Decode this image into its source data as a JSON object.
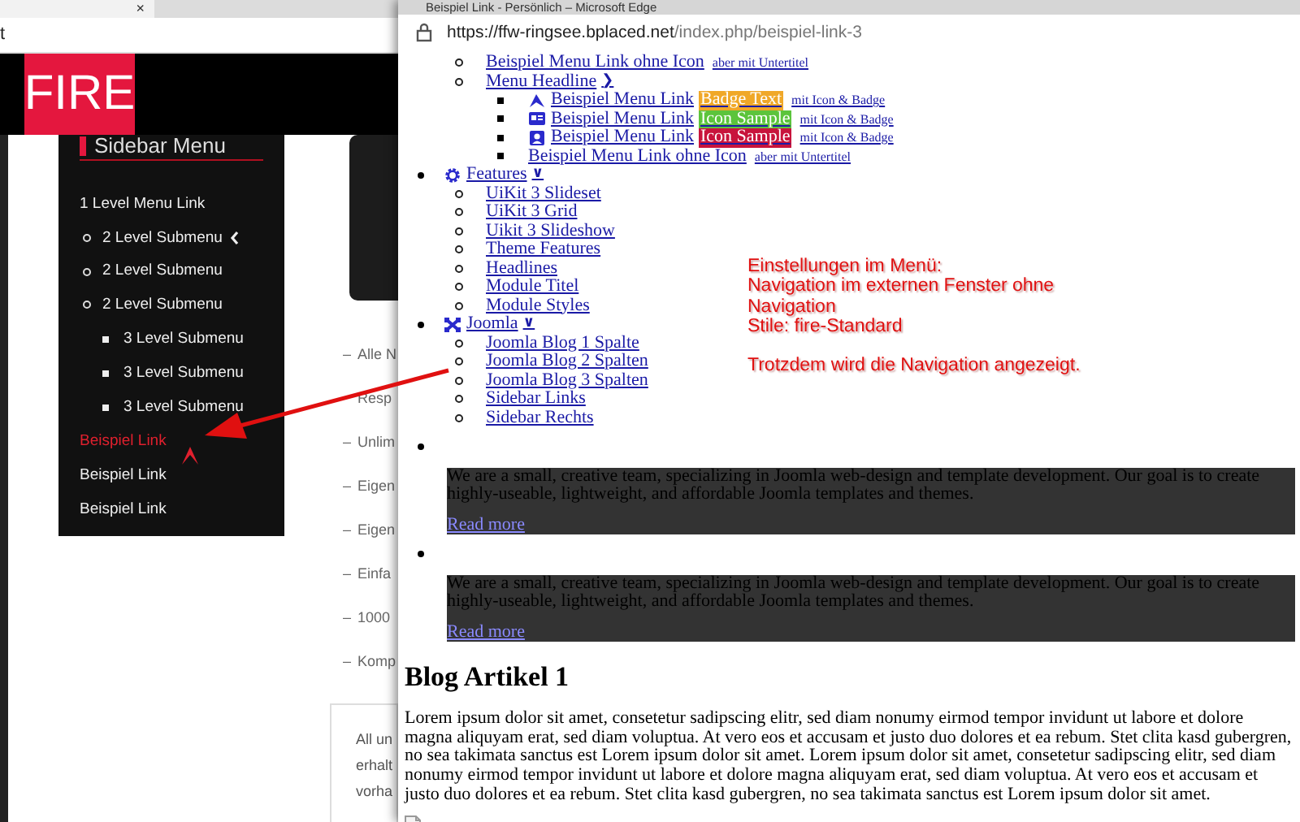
{
  "background_page": {
    "tab_close": "×",
    "address_fragment": "t",
    "logo": "FIRE",
    "sidebar": {
      "title": "Sidebar Menu",
      "items": [
        {
          "label": "1 Level Menu Link",
          "selected": false,
          "children": [
            {
              "label": "2 Level Submenu",
              "selected": false,
              "chevron": true
            },
            {
              "label": "2 Level Submenu",
              "selected": false,
              "chevron": false
            },
            {
              "label": "2 Level Submenu",
              "selected": false,
              "chevron": false,
              "children": [
                {
                  "label": "3 Level Submenu",
                  "selected": false
                },
                {
                  "label": "3 Level Submenu",
                  "selected": false
                },
                {
                  "label": "3 Level Submenu",
                  "selected": false
                }
              ]
            }
          ]
        },
        {
          "label": "Beispiel Link",
          "selected": true
        },
        {
          "label": "Beispiel Link",
          "selected": false
        },
        {
          "label": "Beispiel Link",
          "selected": false
        }
      ]
    },
    "feature_list": [
      {
        "marker": "–",
        "lines": [
          "Alle N",
          "Resp"
        ]
      },
      {
        "marker": "–",
        "lines": [
          "Unlim"
        ]
      },
      {
        "marker": "–",
        "lines": [
          "Eigen"
        ]
      },
      {
        "marker": "–",
        "lines": [
          "Eigen"
        ]
      },
      {
        "marker": "–",
        "lines": [
          "Einfa"
        ]
      },
      {
        "marker": "–",
        "lines": [
          "1000"
        ]
      },
      {
        "marker": "–",
        "lines": [
          "Komp"
        ]
      }
    ],
    "info_box": {
      "lines": [
        "All un",
        "erhalt",
        "vorha"
      ]
    }
  },
  "popup": {
    "title": "Beispiel Link - Persönlich – Microsoft Edge",
    "url_host": "https://ffw-ringsee.bplaced.net",
    "url_path": "/index.php/beispiel-link-3",
    "menu_continued": [
      {
        "label": "Beispiel Menu Link ohne Icon",
        "subtitle": "aber mit Untertitel"
      },
      {
        "label": "Menu Headline",
        "chevron": "❯",
        "children": [
          {
            "kind": "icon",
            "label": "Beispiel Menu Link",
            "badge": {
              "text": "Badge Text",
              "color": "#f0a828"
            },
            "subtitle": "mit Icon & Badge"
          },
          {
            "kind": "icon",
            "label": "Beispiel Menu Link",
            "badge": {
              "text": "Icon Sample",
              "color": "#5cc43c"
            },
            "subtitle": "mit Icon & Badge"
          },
          {
            "kind": "icon",
            "label": "Beispiel Menu Link",
            "badge": {
              "text": "Icon Sample",
              "color": "#c8143c"
            },
            "subtitle": "mit Icon & Badge"
          },
          {
            "kind": "plain",
            "label": "Beispiel Menu Link ohne Icon",
            "subtitle": "aber mit Untertitel"
          }
        ]
      }
    ],
    "menu": [
      {
        "kind": "link",
        "label": "Features",
        "chevron": "∨",
        "children": [
          {
            "label": "UiKit 3 Slideset"
          },
          {
            "label": "UiKit 3 Grid"
          },
          {
            "label": "Uikit 3 Slideshow"
          },
          {
            "label": "Theme Features"
          },
          {
            "label": "Headlines"
          },
          {
            "label": "Module Titel"
          },
          {
            "label": "Module Styles"
          }
        ]
      },
      {
        "kind": "link",
        "label": "Joomla",
        "chevron": "∨",
        "children": [
          {
            "label": "Joomla Blog 1 Spalte"
          },
          {
            "label": "Joomla Blog 2 Spalten"
          },
          {
            "label": "Joomla Blog 3 Spalten"
          },
          {
            "label": "Sidebar Links"
          },
          {
            "label": "Sidebar Rechts"
          }
        ]
      },
      {
        "kind": "module",
        "text": "We are a small, creative team, specializing in Joomla web-design and template development. Our goal is to create highly-useable, lightweight, and affordable Joomla templates and themes.",
        "link": "Read more"
      },
      {
        "kind": "module",
        "text": "We are a small, creative team, specializing in Joomla web-design and template development. Our goal is to create highly-useable, lightweight, and affordable Joomla templates and themes.",
        "link": "Read more"
      }
    ],
    "article": {
      "title": "Blog Artikel 1",
      "text": "Lorem ipsum dolor sit amet, consetetur sadipscing elitr, sed diam nonumy eirmod tempor invidunt ut labore et dolore magna aliquyam erat, sed diam voluptua. At vero eos et accusam et justo duo dolores et ea rebum. Stet clita kasd gubergren, no sea takimata sanctus est Lorem ipsum dolor sit amet. Lorem ipsum dolor sit amet, consetetur sadipscing elitr, sed diam nonumy eirmod tempor invidunt ut labore et dolore magna aliquyam erat, sed diam voluptua. At vero eos et accusam et justo duo dolores et ea rebum. Stet clita kasd gubergren, no sea takimata sanctus est Lorem ipsum dolor sit amet."
    },
    "annotation": {
      "paragraphs": [
        [
          "Einstellungen im Menü:",
          "Navigation im externen Fenster ohne",
          "Navigation",
          "Stile: fire-Standard"
        ],
        [
          "Trotzdem wird die Navigation angezeigt."
        ]
      ]
    }
  }
}
